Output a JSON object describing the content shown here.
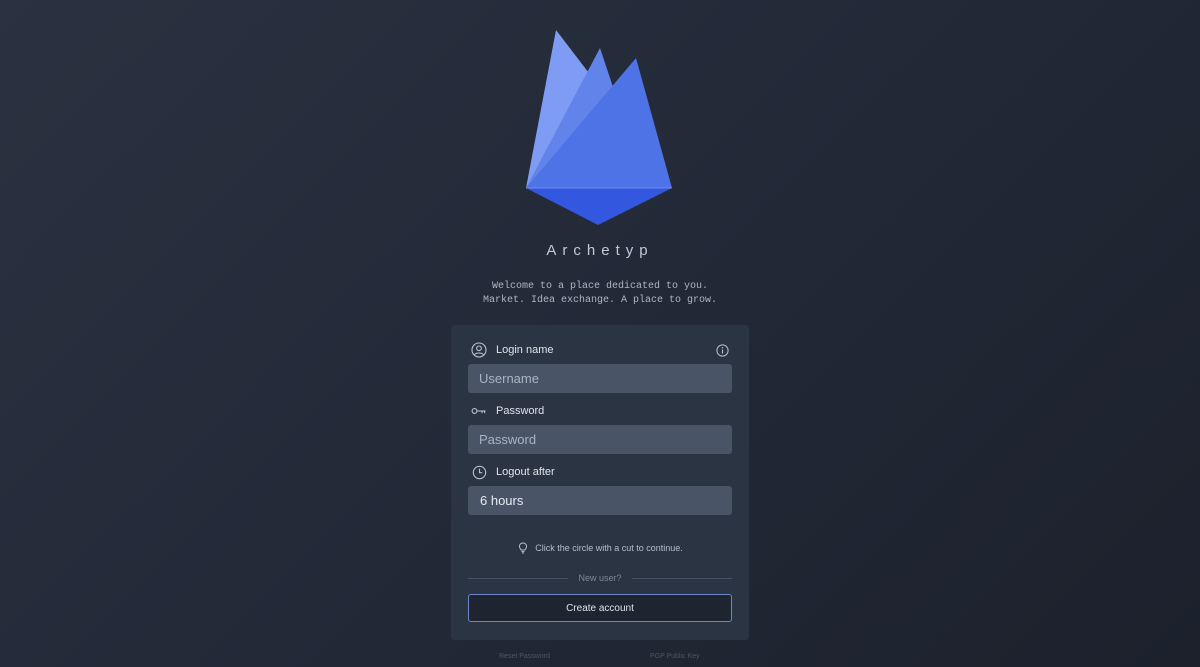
{
  "brand": {
    "name": "Archetyp",
    "tagline_line1": "Welcome to a place dedicated to you.",
    "tagline_line2": "Market. Idea exchange. A place to grow."
  },
  "form": {
    "login_label": "Login name",
    "username_placeholder": "Username",
    "password_label": "Password",
    "password_placeholder": "Password",
    "logout_label": "Logout after",
    "logout_value": "6 hours",
    "captcha_hint": "Click the circle with a cut to continue.",
    "new_user_label": "New user?",
    "create_account_label": "Create account"
  },
  "footer": {
    "reset_password": "Reset Password",
    "pgp_key": "PGP Public Key"
  },
  "icons": {
    "login": "user-circle-icon",
    "info": "info-icon",
    "password": "key-icon",
    "logout": "clock-icon",
    "hint": "lightbulb-icon"
  },
  "colors": {
    "accent": "#4a6fe3",
    "button_border": "#6d87c9",
    "card_bg": "#2b3443",
    "field_bg": "#4a5467"
  }
}
